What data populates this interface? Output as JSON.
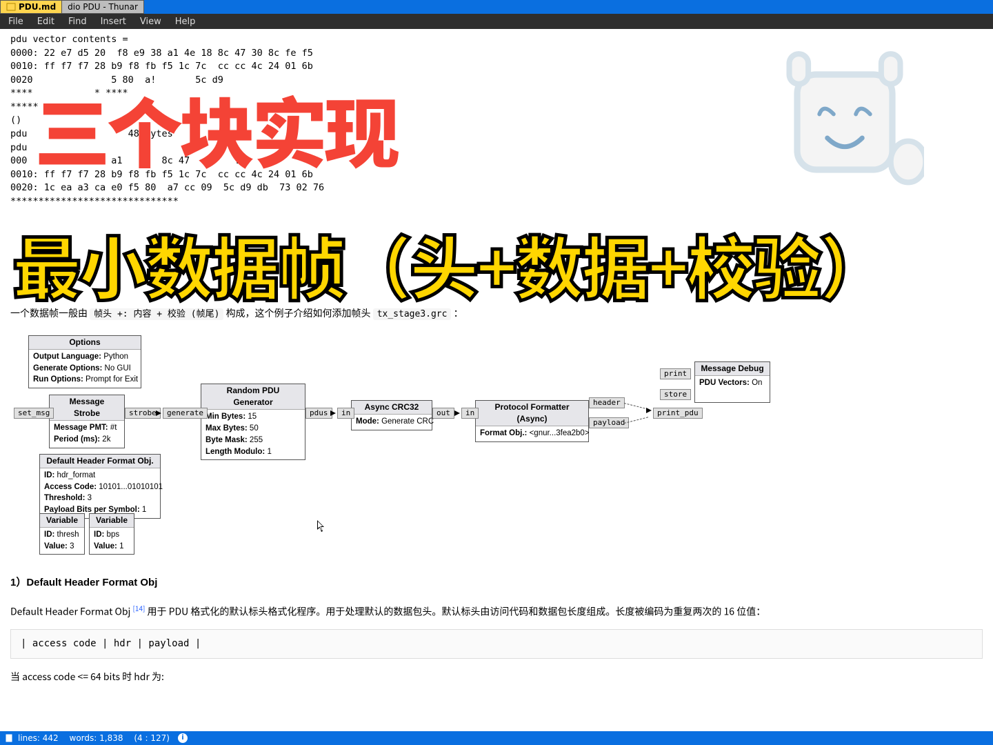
{
  "tabs": [
    {
      "label": "PDU.md",
      "active": true
    },
    {
      "label": "dio PDU - Thunar",
      "active": false
    }
  ],
  "menu": {
    "file": "File",
    "edit": "Edit",
    "find": "Find",
    "insert": "Insert",
    "view": "View",
    "help": "Help"
  },
  "codelines": [
    "pdu vector contents = ",
    "0000: 22 e7 d5 20  f8 e9 38 a1 4e 18 8c 47 30 8c fe f5",
    "0010: ff f7 f7 28 b9 f8 fb f5 1c 7c  cc cc 4c 24 01 6b ",
    "0020              5 80  a!       5c d9                ",
    "****           * ****                                 ",
    "*****                                                 ",
    "()                                                    ",
    "pdu          -       48 ,ytes                         ",
    "pdu                                                   ",
    "000            38 a1       8c 47        .             ",
    "0010: ff f7 f7 28 b9 f8 fb f5 1c 7c  cc cc 4c 24 01 6b ",
    "0020: 1c ea a3 ca e0 f5 80  a7 cc 09  5c d9 db  73 02 76",
    "******************************"
  ],
  "overlay": {
    "red": "三个块实现",
    "yellow": "最小数据帧（头+数据+校验）"
  },
  "prose": {
    "p1_prefix": "一个数据帧一般由",
    "p1_code1": "帧头 +: 内容 + 校验 (帧尾)",
    "p1_mid": "构成，这个例子介绍如何添加帧头",
    "p1_code2": "tx_stage3.grc",
    "p1_suffix": "："
  },
  "blocks": {
    "options": {
      "title": "Options",
      "props": [
        [
          "Output Language:",
          "Python"
        ],
        [
          "Generate Options:",
          "No GUI"
        ],
        [
          "Run Options:",
          "Prompt for Exit"
        ]
      ]
    },
    "strobe": {
      "title": "Message Strobe",
      "props": [
        [
          "Message PMT:",
          "#t"
        ],
        [
          "Period (ms):",
          "2k"
        ]
      ],
      "port_left": "set_msg",
      "port_right": "strobe"
    },
    "rand": {
      "title": "Random PDU Generator",
      "props": [
        [
          "Min Bytes:",
          "15"
        ],
        [
          "Max Bytes:",
          "50"
        ],
        [
          "Byte Mask:",
          "255"
        ],
        [
          "Length Modulo:",
          "1"
        ]
      ],
      "port_left": "generate",
      "port_right": "pdus"
    },
    "crc": {
      "title": "Async CRC32",
      "props": [
        [
          "Mode:",
          "Generate CRC"
        ]
      ],
      "port_left": "in",
      "port_right": "out"
    },
    "fmt": {
      "title": "Protocol Formatter (Async)",
      "props": [
        [
          "Format Obj.:",
          "<gnur...3fea2b0>"
        ]
      ],
      "port_left": "in",
      "port_right_top": "header",
      "port_right_bot": "payload"
    },
    "debug": {
      "title": "Message Debug",
      "props": [
        [
          "PDU Vectors:",
          "On"
        ]
      ],
      "port1": "print",
      "port2": "store",
      "port3": "print_pdu"
    },
    "defhdr": {
      "title": "Default Header Format Obj.",
      "props": [
        [
          "ID:",
          "hdr_format"
        ],
        [
          "Access Code:",
          "10101...01010101"
        ],
        [
          "Threshold:",
          "3"
        ],
        [
          "Payload Bits per Symbol:",
          "1"
        ]
      ]
    },
    "var1": {
      "title": "Variable",
      "props": [
        [
          "ID:",
          "thresh"
        ],
        [
          "Value:",
          "3"
        ]
      ]
    },
    "var2": {
      "title": "Variable",
      "props": [
        [
          "ID:",
          "bps"
        ],
        [
          "Value:",
          "1"
        ]
      ]
    }
  },
  "section1": {
    "heading": "1）Default Header Format Obj",
    "p": "Default Header Format Obj",
    "sup": "[14]",
    "rest": "用于 PDU 格式化的默认标头格式化程序。用于处理默认的数据包头。默认标头由访问代码和数据包长度组成。长度被编码为重复两次的 16 位值：",
    "code": " | access code | hdr  | payload |",
    "p2": "当 access code <= 64 bits 时 hdr 为:"
  },
  "status": {
    "lines_label": "lines:",
    "lines": "442",
    "words_label": "words:",
    "words": "1,838",
    "pos": "(4 : 127)"
  }
}
